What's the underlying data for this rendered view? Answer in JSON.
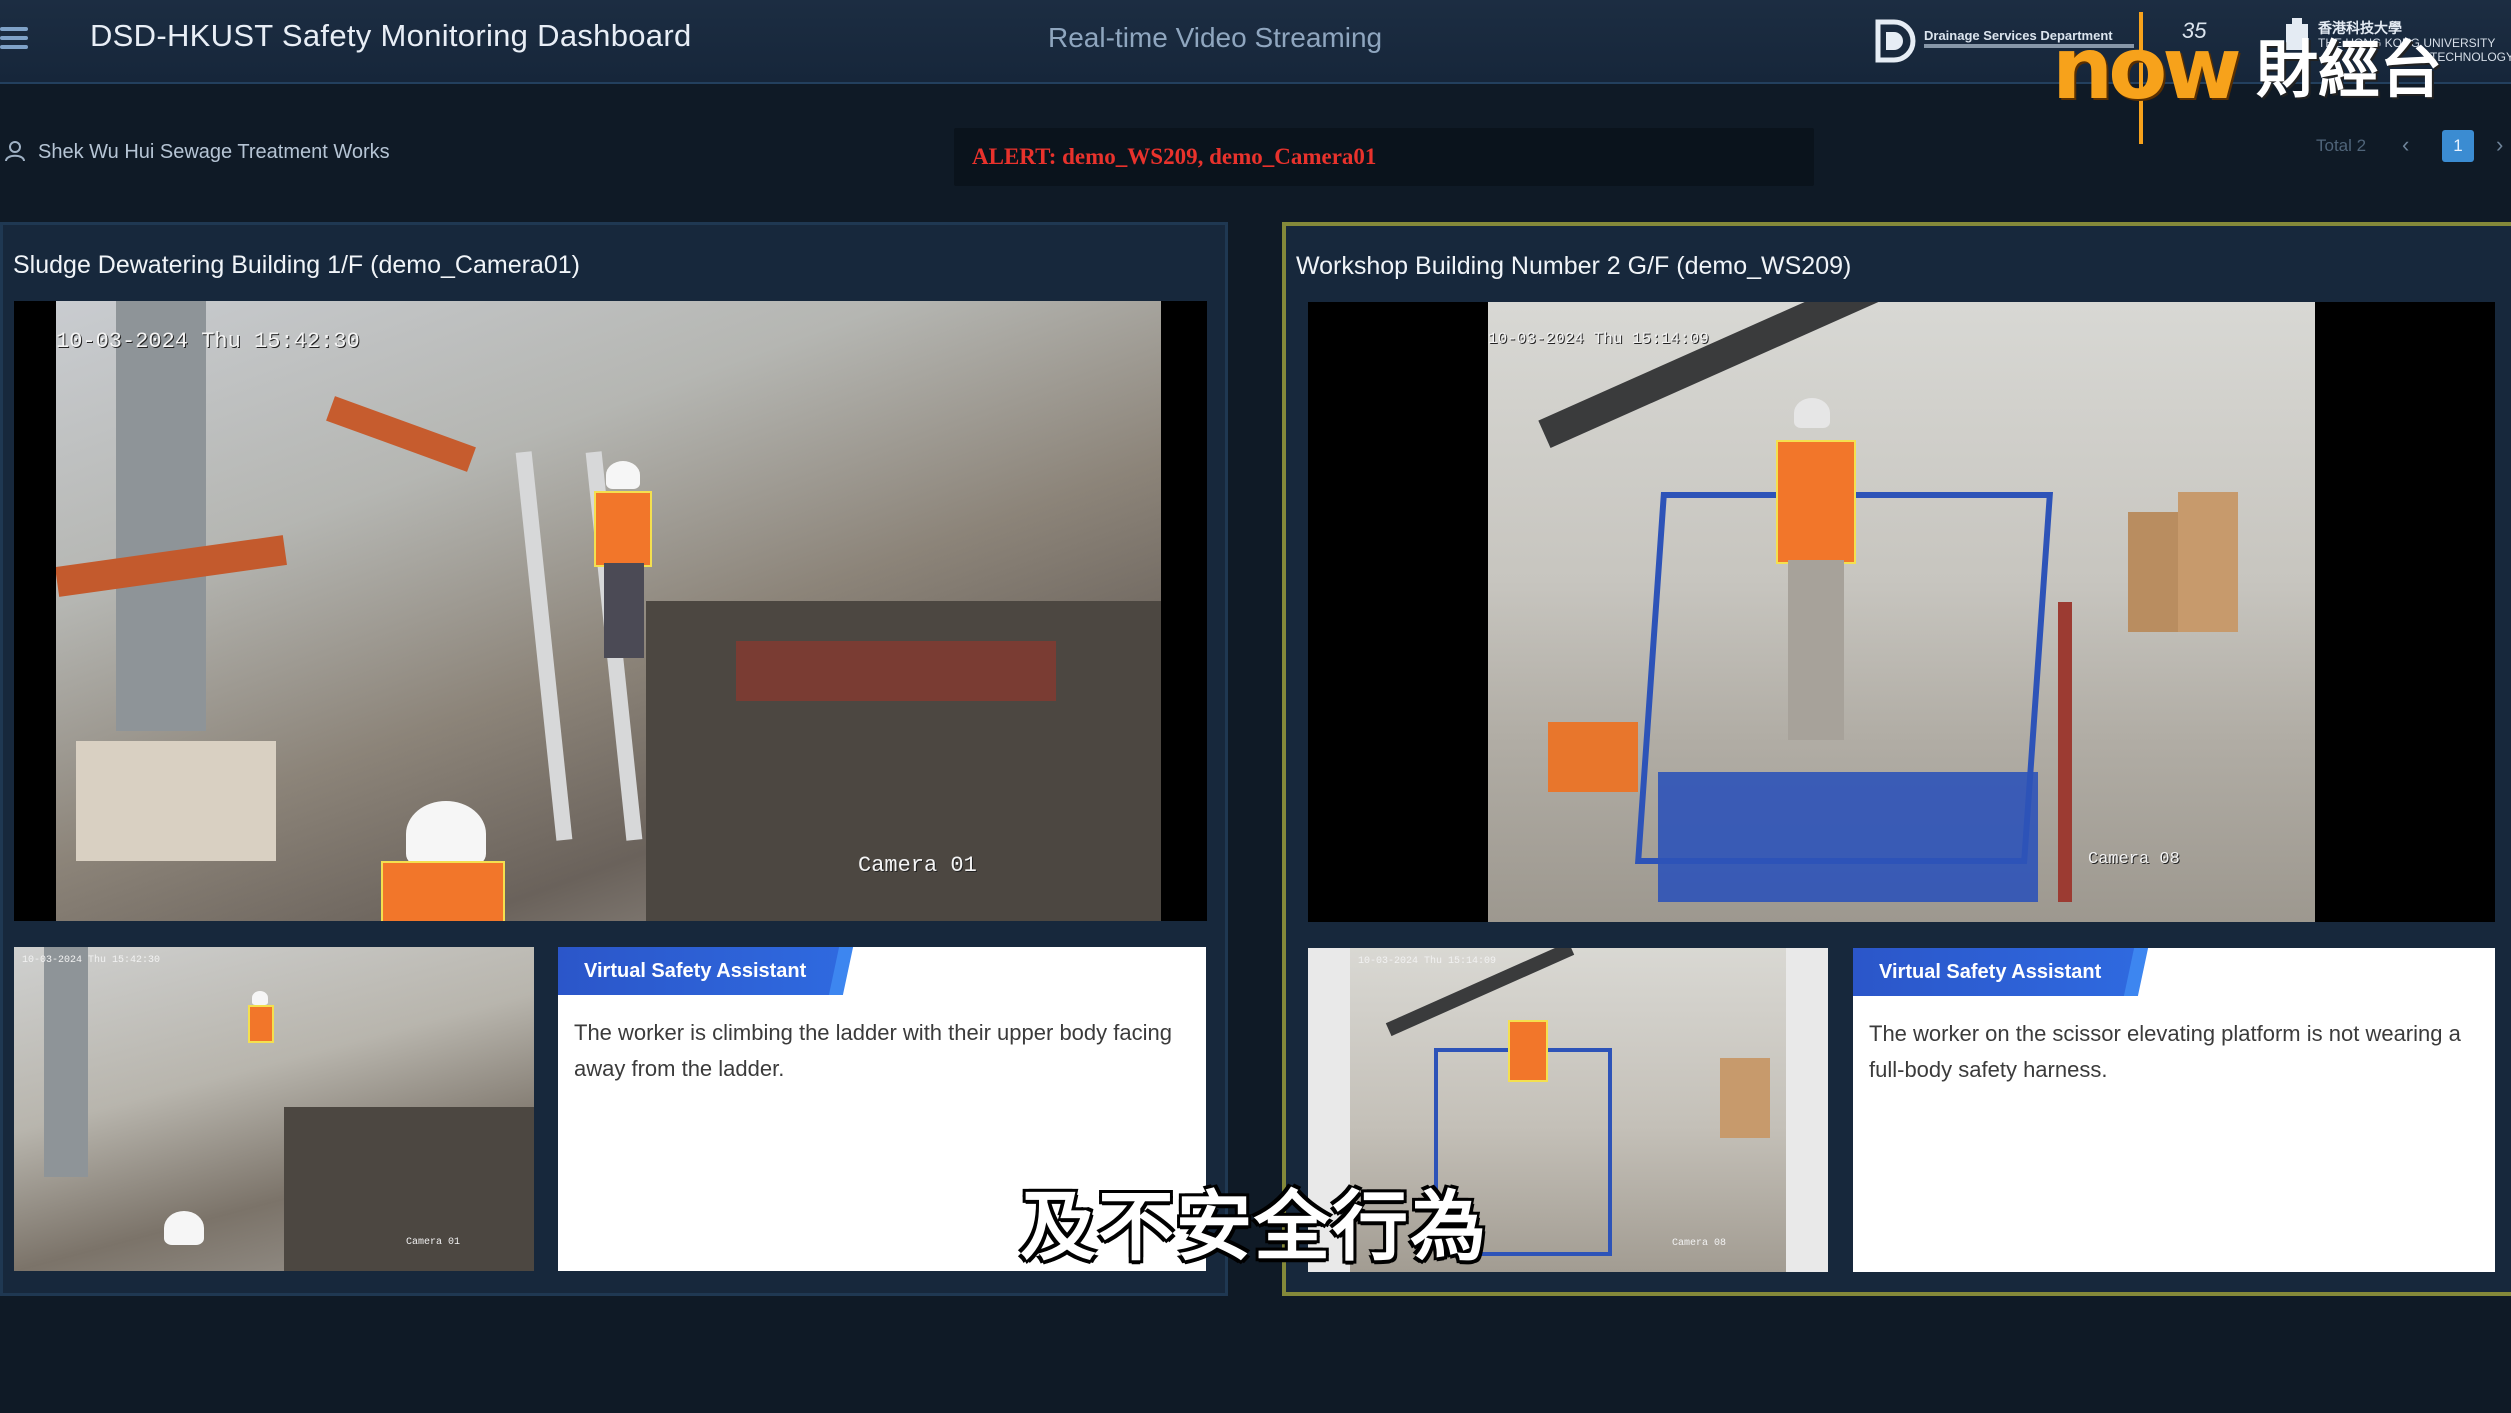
{
  "header": {
    "app_title": "DSD-HKUST Safety Monitoring Dashboard",
    "section_title": "Real-time Video Streaming",
    "dsd_label": "Drainage Services Department",
    "anniversary": "35",
    "hkust_zh": "香港科技大學",
    "hkust_en_line1": "THE HONG KONG UNIVERSITY",
    "hkust_en_line2": "TECHNOLOGY"
  },
  "broadcast": {
    "logo_text": "now",
    "channel_text": "財經台",
    "subtitle": "及不安全行為"
  },
  "site": {
    "name": "Shek Wu Hui Sewage Treatment Works"
  },
  "alert": {
    "text": "ALERT: demo_WS209, demo_Camera01"
  },
  "pager": {
    "total_label": "Total 2",
    "prev": "‹",
    "current_page": "1",
    "next": "›"
  },
  "panels": [
    {
      "title": "Sludge Dewatering Building 1/F (demo_Camera01)",
      "timestamp": "10-03-2024 Thu 15:42:30",
      "camera_label": "Camera 01",
      "thumb_timestamp": "10-03-2024 Thu 15:42:30",
      "thumb_camera_label": "Camera 01",
      "assistant_label": "Virtual Safety Assistant",
      "assistant_message": "The worker is climbing the ladder with their upper body facing away from the ladder."
    },
    {
      "title": "Workshop Building Number 2 G/F (demo_WS209)",
      "timestamp": "10-03-2024 Thu 15:14:09",
      "camera_label": "Camera 08",
      "thumb_timestamp": "10-03-2024 Thu 15:14:09",
      "thumb_camera_label": "Camera 08",
      "assistant_label": "Virtual Safety Assistant",
      "assistant_message": "The worker on the scissor elevating platform is not wearing a full-body safety harness."
    }
  ],
  "colors": {
    "alert": "#e8322c",
    "accent_blue": "#3b8cd2",
    "badge_blue": "#2b56c9",
    "alert_panel_border": "#84893a",
    "broadcast_orange": "#f7a21b"
  }
}
